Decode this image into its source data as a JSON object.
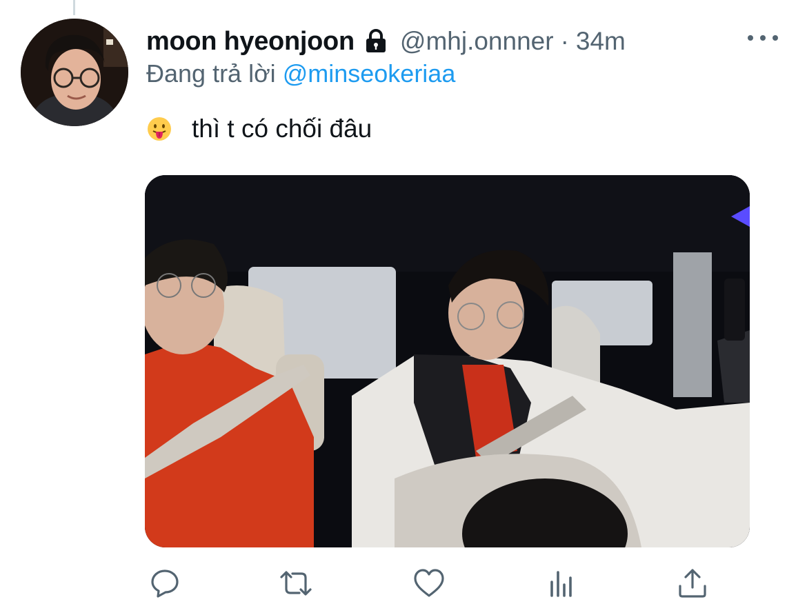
{
  "tweet": {
    "display_name": "moon hyeonjoon",
    "handle": "@mhj.onnner",
    "separator": "·",
    "time": "34m",
    "reply_prefix": "Đang trả lời",
    "reply_to": "@minseokeriaa",
    "text": "thì t có chối đâu",
    "emoji": "face-with-tongue",
    "protected": true
  },
  "colors": {
    "accent": "#1d9bf0",
    "secondary_text": "#536471",
    "primary_text": "#0f1419"
  },
  "actions": [
    {
      "name": "reply",
      "icon": "comment-icon"
    },
    {
      "name": "retweet",
      "icon": "retweet-icon"
    },
    {
      "name": "like",
      "icon": "heart-icon"
    },
    {
      "name": "analytics",
      "icon": "analytics-icon"
    },
    {
      "name": "share",
      "icon": "share-icon"
    }
  ]
}
